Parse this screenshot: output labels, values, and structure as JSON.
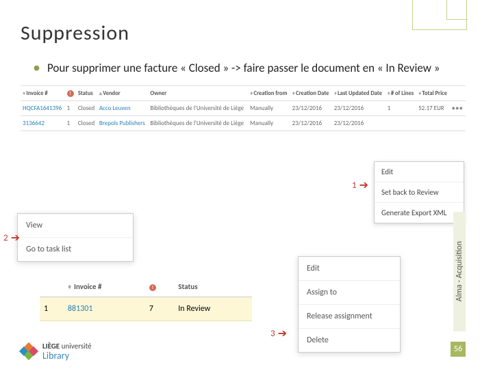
{
  "title": "Suppression",
  "bullet_text": "Pour supprimer une facture « Closed » -> faire passer le document en « In Review »",
  "table1": {
    "headers": [
      "Invoice #",
      "",
      "Status",
      "Vendor",
      "Owner",
      "Creation from",
      "Creation Date",
      "Last Updated Date",
      "# of Lines",
      "Total Price",
      ""
    ],
    "rows": [
      [
        "HQCFA1641396",
        "1",
        "Closed",
        "Acco Leuven",
        "Bibliothèques de l'Université de Liège",
        "Manually",
        "23/12/2016",
        "23/12/2016",
        "1",
        "52.17 EUR",
        "..."
      ],
      [
        "3136642",
        "1",
        "Closed",
        "Brepols Publishers",
        "Bibliothèques de l'Université de Liège",
        "Manually",
        "23/12/2016",
        "23/12/2016",
        "",
        "",
        ""
      ]
    ]
  },
  "menu1": {
    "items": [
      "Edit",
      "Set back to Review",
      "Generate Export XML"
    ]
  },
  "panel2": {
    "items": [
      "View",
      "Go to task list"
    ]
  },
  "table2": {
    "headers": [
      "",
      "Invoice #",
      "",
      "Status"
    ],
    "row": [
      "1",
      "881301",
      "7",
      "In Review"
    ]
  },
  "menu3": {
    "items": [
      "Edit",
      "Assign to",
      "Release assignment",
      "Delete"
    ]
  },
  "markers": {
    "m1": "1",
    "m2": "2",
    "m3": "3"
  },
  "sidebar_label": "Alma - Acquisition",
  "page_number": "56",
  "logo": {
    "line1_a": "LIÈGE",
    "line1_b": "université",
    "line2": "Library"
  }
}
